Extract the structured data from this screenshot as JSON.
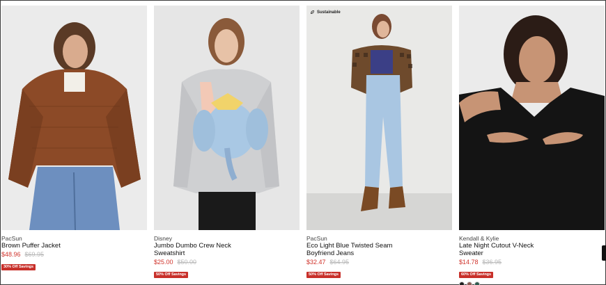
{
  "products": [
    {
      "brand": "PacSun",
      "name": "Brown Puffer Jacket",
      "sale_price": "$48.96",
      "original_price": "$69.95",
      "badge": "30% Off Savings",
      "image_icon": "product-photo-brown-puffer-jacket"
    },
    {
      "brand": "Disney",
      "name_line1": "Jumbo Dumbo Crew Neck",
      "name_line2": "Sweatshirt",
      "sale_price": "$25.00",
      "original_price": "$50.00",
      "badge": "50% Off Savings",
      "image_icon": "product-photo-dumbo-sweatshirt"
    },
    {
      "brand": "PacSun",
      "name_line1": "Eco Light Blue Twisted Seam",
      "name_line2": "Boyfriend Jeans",
      "sale_price": "$32.47",
      "original_price": "$64.95",
      "badge": "50% Off Savings",
      "tag": "Sustainable",
      "image_icon": "product-photo-blue-jeans"
    },
    {
      "brand": "Kendall & Kylie",
      "name_line1": "Late Night Cutout V-Neck",
      "name_line2": "Sweater",
      "sale_price": "$14.78",
      "original_price": "$36.95",
      "badge": "60% Off Savings",
      "swatches": [
        "#1f1f1f",
        "#8a5a52",
        "#2f5a4e"
      ],
      "image_icon": "product-photo-black-cutout-sweater"
    }
  ],
  "colors": {
    "sale": "#d0342c",
    "badge": "#c8302a",
    "strike": "#b8b8b8"
  }
}
